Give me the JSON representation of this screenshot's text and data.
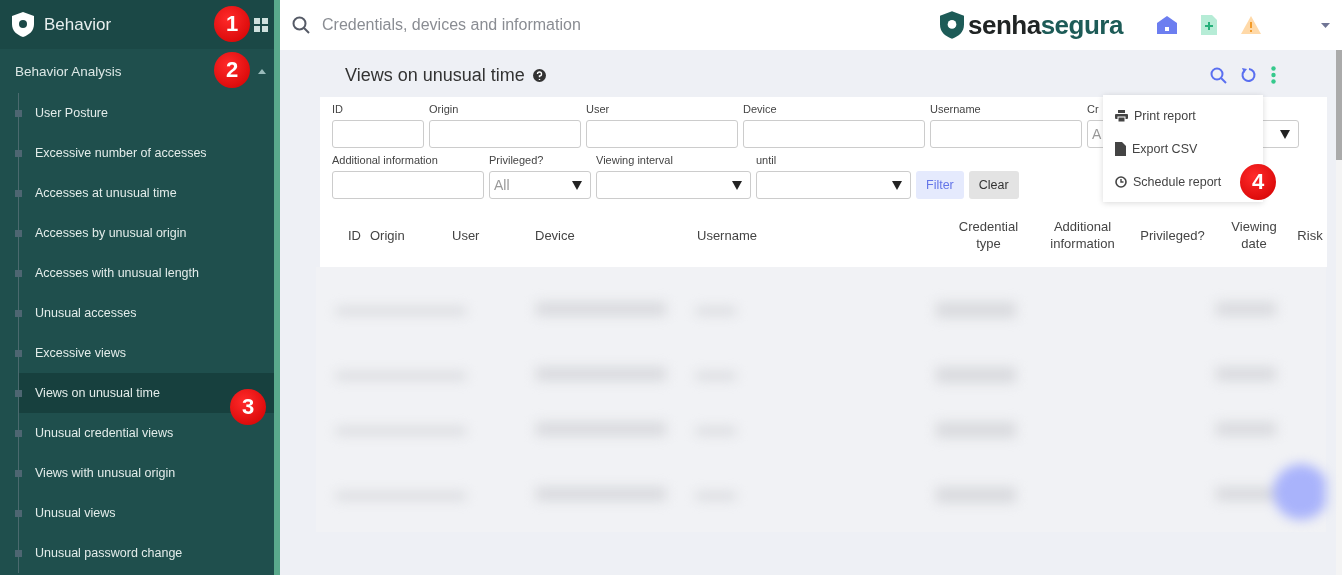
{
  "sidebar": {
    "title": "Behavior",
    "section": {
      "label": "Behavior Analysis",
      "expanded": true
    },
    "items": [
      {
        "label": "User Posture",
        "selected": false
      },
      {
        "label": "Excessive number of accesses",
        "selected": false
      },
      {
        "label": "Accesses at unusual time",
        "selected": false
      },
      {
        "label": "Accesses by unusual origin",
        "selected": false
      },
      {
        "label": "Accesses with unusual length",
        "selected": false
      },
      {
        "label": "Unusual accesses",
        "selected": false
      },
      {
        "label": "Excessive views",
        "selected": false
      },
      {
        "label": "Views on unusual time",
        "selected": true
      },
      {
        "label": "Unusual credential views",
        "selected": false
      },
      {
        "label": "Views with unusual origin",
        "selected": false
      },
      {
        "label": "Unusual views",
        "selected": false
      },
      {
        "label": "Unusual password change",
        "selected": false
      }
    ]
  },
  "topbar": {
    "search_placeholder": "Credentials, devices and information",
    "logo": {
      "part_1": "senha",
      "part_2": "segura"
    }
  },
  "page": {
    "title": "Views on unusual time"
  },
  "filters": [
    {
      "kind": "input",
      "label": "ID"
    },
    {
      "kind": "input",
      "label": "Origin"
    },
    {
      "kind": "input",
      "label": "User"
    },
    {
      "kind": "input",
      "label": "Device"
    },
    {
      "kind": "input",
      "label": "Username"
    },
    {
      "kind": "select",
      "label": "Cr",
      "value": "A"
    },
    {
      "kind": "input",
      "label": "Additional information"
    },
    {
      "kind": "select",
      "label": "Privileged?",
      "value": "All"
    },
    {
      "kind": "select",
      "label": "Viewing interval"
    },
    {
      "kind": "select",
      "label": "until"
    }
  ],
  "buttons": [
    {
      "kind": "primary",
      "label": "Filter"
    },
    {
      "kind": "secondary",
      "label": "Clear"
    }
  ],
  "table": {
    "columns": [
      "ID",
      "Origin",
      "User",
      "Device",
      "Username",
      "Credential type",
      "Additional information",
      "Privileged?",
      "Viewing date",
      "Risk"
    ]
  },
  "menu": {
    "items": [
      {
        "kind": "print",
        "label": "Print report"
      },
      {
        "kind": "file",
        "label": "Export CSV"
      },
      {
        "kind": "clock",
        "label": "Schedule report"
      }
    ]
  },
  "annotations": [
    "1",
    "2",
    "3",
    "4"
  ]
}
